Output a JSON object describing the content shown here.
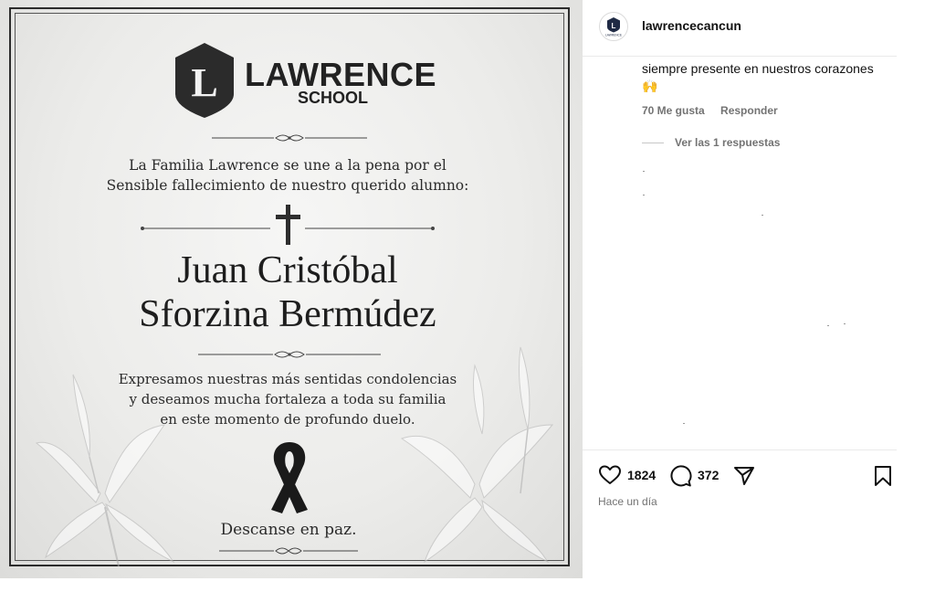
{
  "post": {
    "logo": {
      "name": "LAWRENCE",
      "sub": "SCHOOL",
      "letter": "L",
      "shield_color": "#2b2b2b"
    },
    "intro_line1": "La Familia Lawrence se une a la pena por el",
    "intro_line2": "Sensible fallecimiento de nuestro querido alumno:",
    "name_line1": "Juan Cristóbal",
    "name_line2": "Sforzina Bermúdez",
    "condolence_line1": "Expresamos nuestras más sentidas condolencias",
    "condolence_line2": "y deseamos mucha fortaleza a toda su familia",
    "condolence_line3": "en este momento de profundo duelo.",
    "closing": "Descanse en paz."
  },
  "panel": {
    "username": "lawrencecancun",
    "avatar_text": "LAWRENCE",
    "comment": {
      "text": "siempre presente en nuestros corazones 🙌",
      "likes": "70 Me gusta",
      "reply": "Responder",
      "view_replies": "Ver las 1 respuestas"
    },
    "likes_count": "1824",
    "comments_count": "372",
    "timestamp": "Hace un día"
  },
  "icons": [
    "heart-icon",
    "comment-icon",
    "share-icon",
    "bookmark-icon",
    "cross-icon",
    "ribbon-icon"
  ]
}
